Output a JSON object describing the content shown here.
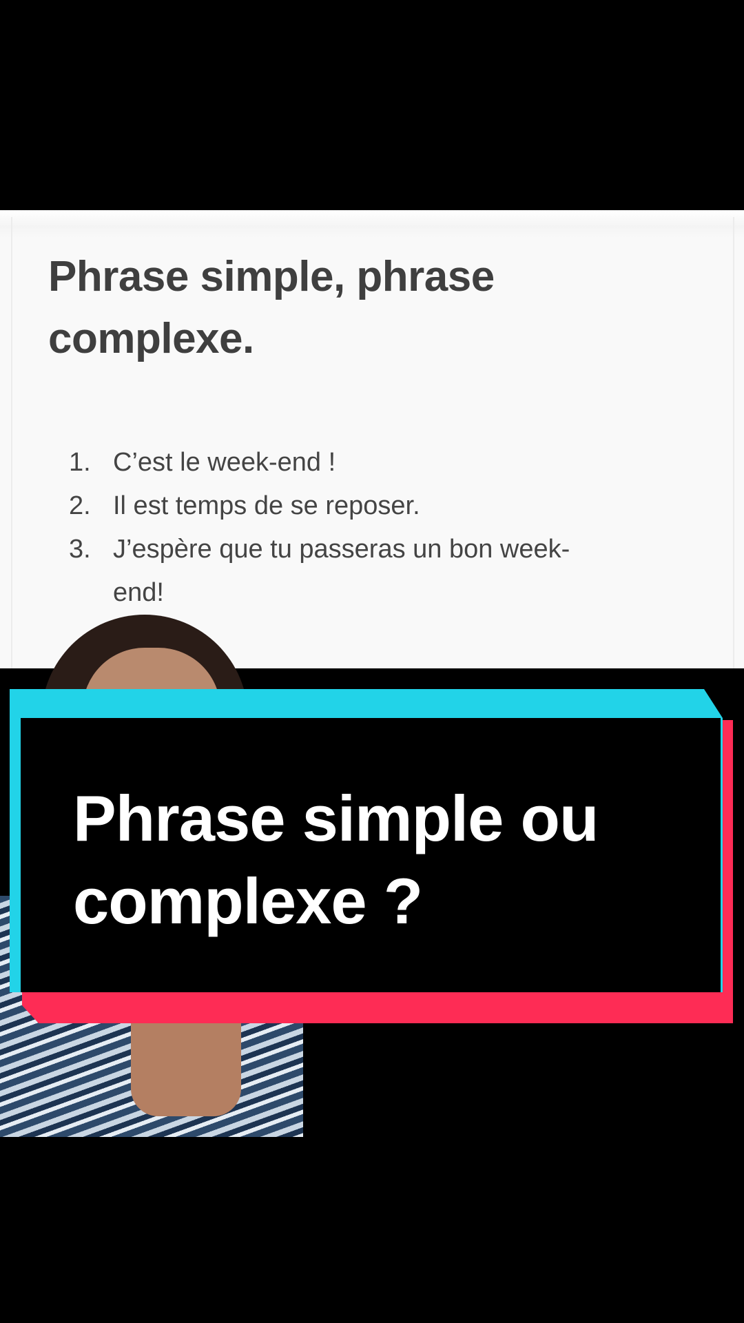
{
  "document": {
    "title_line1": "Phrase simple, phrase",
    "title_line2": "complexe.",
    "items": [
      {
        "number": "1.",
        "text": "C’est le week-end !"
      },
      {
        "number": "2.",
        "text": "Il est temps de se reposer."
      },
      {
        "number": "3.",
        "text": "J’espère que tu passeras un bon week-",
        "text_cont": "end!"
      }
    ]
  },
  "caption": {
    "line1": "Phrase simple ou",
    "line2": "complexe ?"
  },
  "colors": {
    "background": "#000000",
    "document_bg": "#f9f9f9",
    "caption_cyan": "#22d3e8",
    "caption_red": "#fe2c55",
    "caption_text": "#ffffff"
  }
}
